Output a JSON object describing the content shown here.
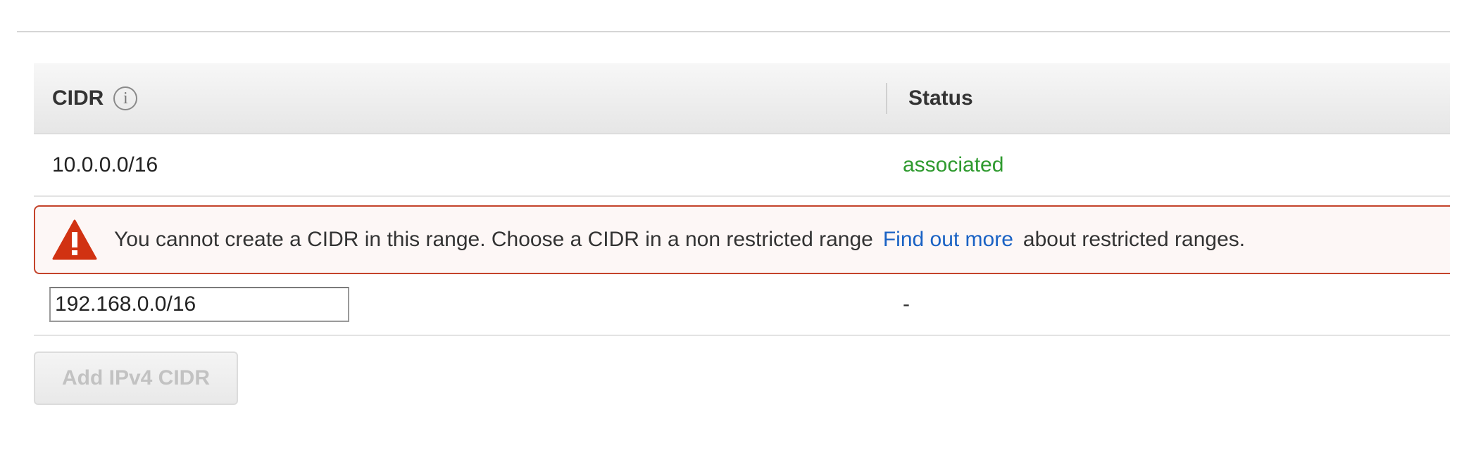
{
  "table": {
    "headers": {
      "cidr": "CIDR",
      "status": "Status"
    },
    "info_icon_glyph": "i",
    "rows": [
      {
        "cidr": "10.0.0.0/16",
        "status": "associated"
      }
    ]
  },
  "error": {
    "icon": "warning-triangle-icon",
    "message": "You cannot create a CIDR in this range. Choose a CIDR in a non restricted range",
    "link_label": "Find out more",
    "message_suffix": "about restricted ranges."
  },
  "new_row": {
    "cidr_value": "192.168.0.0/16",
    "status": "-"
  },
  "add_button": {
    "label": "Add IPv4 CIDR",
    "disabled": true
  },
  "colors": {
    "status_ok": "#2e9a2e",
    "error_border": "#c4432a",
    "error_icon": "#d13212",
    "link": "#1a62c4"
  }
}
